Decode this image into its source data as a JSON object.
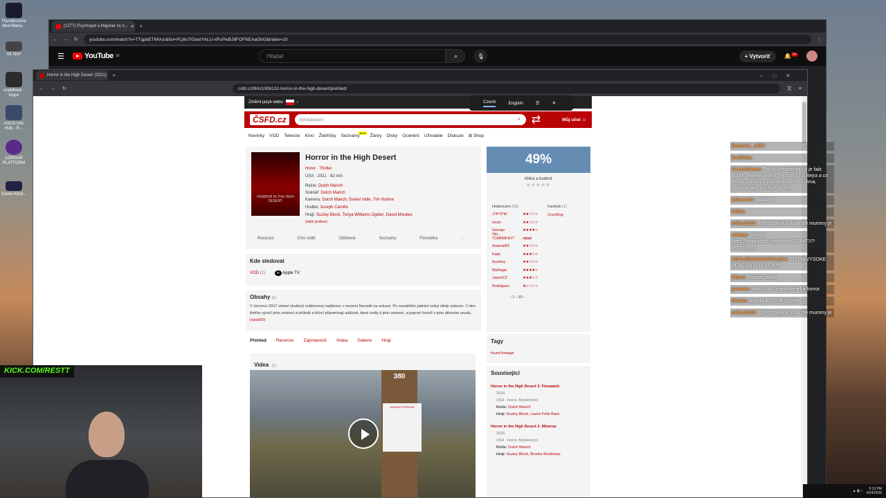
{
  "desktop": {
    "icons": [
      {
        "label": "Thunderstore Mod Mana..."
      },
      {
        "label": "SK NAY"
      },
      {
        "label": "undefined - Imgur"
      },
      {
        "label": "ASUS Info Hub - R..."
      },
      {
        "label": "LORGAR PLATFORM"
      },
      {
        "label": "Darek-Kilvd..."
      }
    ]
  },
  "outer_browser": {
    "tab_title": "(1277) Psychopat a Majsner vs n...",
    "url": "youtube.com/watch?v=TTqpbETMVuc&list=PLj6sTlOuetYALU-xRsPwBJ8FOFNEAaGhG&index=10"
  },
  "youtube": {
    "logo": "YouTube",
    "country": "SK",
    "search_placeholder": "Hľadať",
    "create_label": "Vytvoriť",
    "notif_count": "9+"
  },
  "inner_browser": {
    "tab_title": "Horror in the High Desert (2021)",
    "url": "csfd.cz/film/1006132-horror-in-the-high-desert/prehled/"
  },
  "translate_popup": {
    "lang1": "Czech",
    "lang2": "English"
  },
  "csfd": {
    "lang_strip": "Změnit jazyk webu",
    "search_placeholder": "Vyhledávání",
    "user_label": "Můj účet",
    "nav": [
      "Novinky",
      "VOD",
      "Televize",
      "Kino",
      "Žebříčky",
      "Seznamy",
      "Žánry",
      "Disky",
      "Ocenění",
      "Uživatelé",
      "Diskuze",
      "Shop"
    ],
    "nav_new_badge": "NEW",
    "film": {
      "title": "Horror in the High Desert",
      "genre1": "Horor",
      "genre2": "Thriller",
      "country": "USA",
      "year": "2021",
      "length": "82 min",
      "directing_label": "Režie:",
      "directing": "Dutch Marich",
      "screenplay_label": "Scénář:",
      "screenplay": "Dutch Marich",
      "camera_label": "Kamera:",
      "camera": "Dutch Marich, Daniel Valle, Tim Vidrine",
      "music_label": "Hudba:",
      "music": "Joseph Camillo",
      "cast_label": "Hrají:",
      "cast": "Suziey Block, Tonya Williams Ogden, David Morales",
      "more": "(další profese)",
      "poster_text": "HORROR IN THE HIGH DESERT"
    },
    "actions": [
      "Recenze",
      "Chci vidět",
      "Oblíbené",
      "Seznamy",
      "Filmotéka",
      "···"
    ],
    "where_to_watch": "Kde sledovat",
    "vod_label": "VOD",
    "vod_count": "(1)",
    "apple_tv": "Apple TV",
    "content_title": "Obsahy",
    "content_count": "(1)",
    "plot": "V červenci 2017 zmizel zkušený outdoorový nadšenec v severní Nevadě na exkurzi. Po rozsáhlém pátrání nebyl nikdy nalezen. V den třetího výročí jeho zmizení si přátelé a blízcí připomínají události, které vedly k jeho zmizení, a poprvé hovoří o jeho děsivém osudu.",
    "plot_author": "(rukiu009)",
    "subtabs": [
      "Přehled",
      "Recenze",
      "Zajímavosti",
      "Videa",
      "Galerie",
      "Hrají"
    ],
    "videos_title": "Videa",
    "videos_count": "(1)",
    "rating": "49%",
    "rate_label": "Klikni a hodnoť",
    "ratings_header": "Hodnocení",
    "ratings_count": "(93)",
    "fanclub_header": "Fanklub",
    "fanclub_count": "(1)",
    "fanclub_member": "CrocKing",
    "raters": [
      {
        "name": "J*A*S*M",
        "stars": "★★☆☆☆"
      },
      {
        "name": "riezis",
        "stars": "★★☆☆☆"
      },
      {
        "name": "George Sto...",
        "stars": "★★★★☆"
      },
      {
        "name": "*CARNIFEX*",
        "stars": "odpad"
      },
      {
        "name": "Arsenal83",
        "stars": "★★☆☆☆"
      },
      {
        "name": "Kaiin",
        "stars": "★★★☆☆"
      },
      {
        "name": "faceboy",
        "stars": "★★☆☆☆"
      },
      {
        "name": "Mythago",
        "stars": "★★★★☆"
      },
      {
        "name": "JasonCZ",
        "stars": "★★★☆☆"
      },
      {
        "name": "Rodriguez",
        "stars": "★☆☆☆☆"
      }
    ],
    "pager": "1 - 10",
    "tags_title": "Tagy",
    "tag": "found footage",
    "related_title": "Související",
    "related": [
      {
        "title": "Horror in the High Desert 3: Firewatch",
        "year": "2024",
        "genre": "USA · Horor, Mysteriózní",
        "director": "Dutch Marich",
        "cast": "Suziey Block, Laurie Felix Bass"
      },
      {
        "title": "Horror in the High Desert 2: Minerva",
        "year": "2023",
        "genre": "USA · Horor, Mysteriózní",
        "director": "Dutch Marich",
        "cast": "Suziey Block, Brooke Bradshaw"
      }
    ],
    "video_sign": "MISSING PERSON",
    "pole_number": "380"
  },
  "chat": [
    {
      "user": "Dominic_1337:",
      "text": ""
    },
    {
      "user": "hanlicka:",
      "text": ""
    },
    {
      "user": "CzechClown:",
      "text": "Ten tvůj mozeček už je fakt dobře degenerovaný. Ty čumíš na Bejra a co minutu mluvíš o pičovinách mimo téma. Strašně tady to chuč @restt"
    },
    {
      "user": "Adam174:",
      "text": "ajabiwat"
    },
    {
      "user": "hiška:",
      "text": ""
    },
    {
      "user": "milos1222:",
      "text": "@restt nejaka nova the mummy je"
    },
    {
      "user": "mlekai:",
      "text": "@restt https://www.imdb.com/title/tt0288477/?ref_=fn_t_2"
    },
    {
      "user": "KOTLEBANASSTRAZ14:",
      "text": "TO MA VYSOKE PERCENTA PCH 26%"
    },
    {
      "user": "Slaxo:",
      "text": "hledna sasek"
    },
    {
      "user": "prontex:",
      "text": "mrkni na Undertone jeba horror"
    },
    {
      "user": "Heisio:",
      "text": "poser Last Shift @restt"
    },
    {
      "user": "milos1222:",
      "text": "@restt nejaka nova the mummy je"
    }
  ],
  "stream": {
    "kick_label": "KICK.COM/RESTT"
  },
  "taskbar": {
    "time": "9:13 PM",
    "date": "4/24/2026"
  }
}
